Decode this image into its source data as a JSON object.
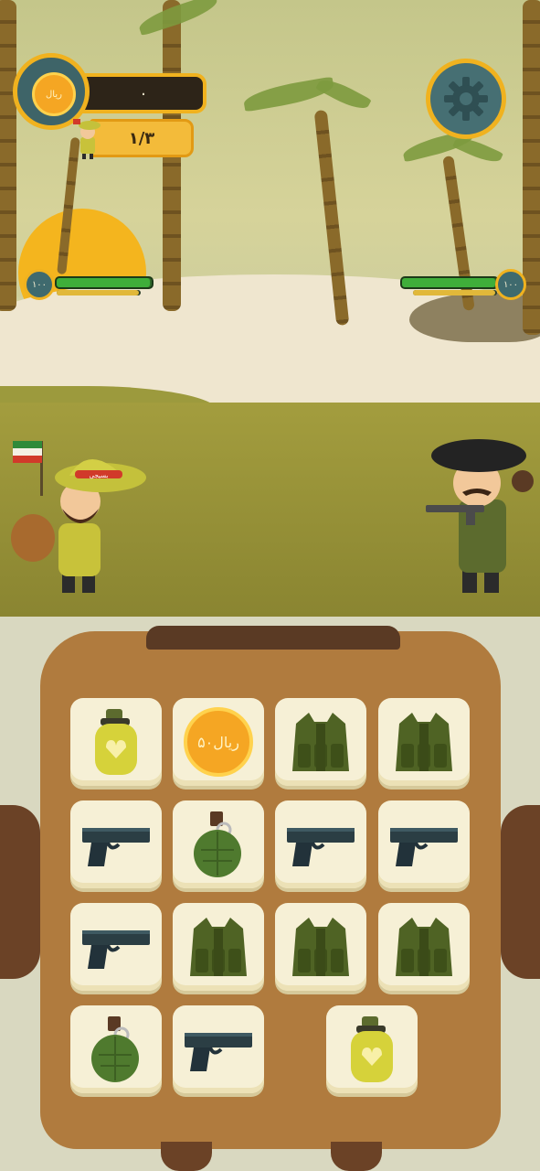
{
  "hud": {
    "coin_label": "ریال",
    "score": "۰",
    "level": "۱/۳"
  },
  "player": {
    "health": "۱۰۰",
    "health_fraction": 0.98,
    "energy_fraction": 0.98
  },
  "enemy": {
    "health": "۱۰۰",
    "health_fraction": 0.98,
    "energy_fraction": 0.98
  },
  "player_badge_text": "بسیجی",
  "inventory": [
    {
      "item": "canteen"
    },
    {
      "item": "coin",
      "label": "۵۰ریال"
    },
    {
      "item": "vest"
    },
    {
      "item": "vest"
    },
    {
      "item": "pistol"
    },
    {
      "item": "grenade"
    },
    {
      "item": "pistol"
    },
    {
      "item": "pistol"
    },
    {
      "item": "pistol"
    },
    {
      "item": "vest"
    },
    {
      "item": "vest"
    },
    {
      "item": "vest"
    },
    {
      "item": "grenade"
    },
    {
      "item": "pistol"
    },
    {
      "item": "canteen"
    }
  ],
  "colors": {
    "accent": "#f0b21f",
    "backpack": "#b07b3e",
    "card": "#f6f0d6"
  },
  "icons": {
    "settings": "gear-icon",
    "coin": "coin-icon"
  }
}
